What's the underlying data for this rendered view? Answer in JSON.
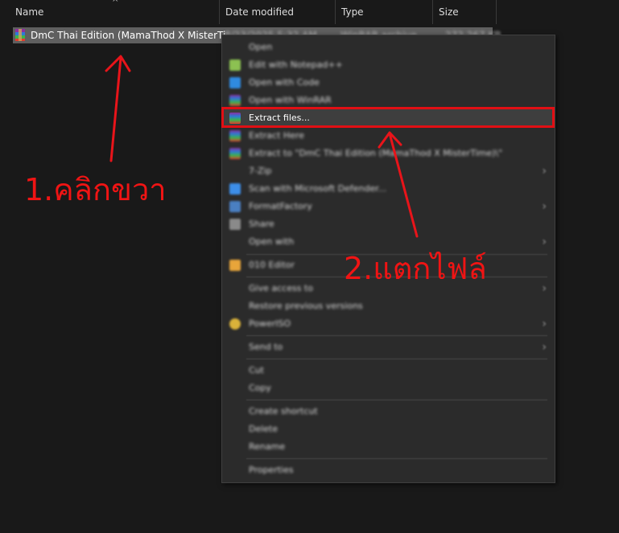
{
  "columns": {
    "name": "Name",
    "date_modified": "Date modified",
    "type": "Type",
    "size": "Size"
  },
  "file": {
    "name": "DmC Thai Edition (MamaThod X MisterTi...",
    "date": "8/23/2025 5:32 AM",
    "type": "WinRAR archive",
    "size": "272,267 KB",
    "icon": "winrar-archive-icon"
  },
  "menu": {
    "items": [
      {
        "label": "Open",
        "icon": "",
        "submenu": false
      },
      {
        "label": "Edit with Notepad++",
        "icon": "notepad-plus-icon",
        "submenu": false
      },
      {
        "label": "Open with Code",
        "icon": "vscode-icon",
        "submenu": false
      },
      {
        "label": "Open with WinRAR",
        "icon": "winrar-icon",
        "submenu": false
      },
      {
        "label": "Extract files...",
        "icon": "winrar-icon",
        "submenu": false,
        "highlighted": true
      },
      {
        "label": "Extract Here",
        "icon": "winrar-icon",
        "submenu": false
      },
      {
        "label": "Extract to \"DmC Thai Edition (MamaThod X MisterTime)\\\"",
        "icon": "winrar-icon",
        "submenu": false
      },
      {
        "label": "7-Zip",
        "icon": "",
        "submenu": true
      },
      {
        "label": "Scan with Microsoft Defender...",
        "icon": "defender-icon",
        "submenu": false
      },
      {
        "label": "FormatFactory",
        "icon": "formatfactory-icon",
        "submenu": true
      },
      {
        "label": "Share",
        "icon": "share-icon",
        "submenu": false
      },
      {
        "label": "Open with",
        "icon": "",
        "submenu": true
      },
      {
        "label": "010 Editor",
        "icon": "010-editor-icon",
        "submenu": false
      },
      {
        "label": "Give access to",
        "icon": "",
        "submenu": true
      },
      {
        "label": "Restore previous versions",
        "icon": "",
        "submenu": false
      },
      {
        "label": "PowerISO",
        "icon": "poweriso-icon",
        "submenu": true
      },
      {
        "label": "Send to",
        "icon": "",
        "submenu": true
      },
      {
        "label": "Cut",
        "icon": "",
        "submenu": false
      },
      {
        "label": "Copy",
        "icon": "",
        "submenu": false
      },
      {
        "label": "Create shortcut",
        "icon": "",
        "submenu": false
      },
      {
        "label": "Delete",
        "icon": "",
        "submenu": false
      },
      {
        "label": "Rename",
        "icon": "",
        "submenu": false
      },
      {
        "label": "Properties",
        "icon": "",
        "submenu": false
      }
    ]
  },
  "annotations": {
    "step1": "1.คลิกขวา",
    "step2": "2.แตกไฟล์",
    "color": "#f01414"
  },
  "colors": {
    "background": "#191919",
    "menu_background": "#2b2b2b",
    "selected_row": "#5f5f5f",
    "highlight_border": "#e10f14"
  }
}
